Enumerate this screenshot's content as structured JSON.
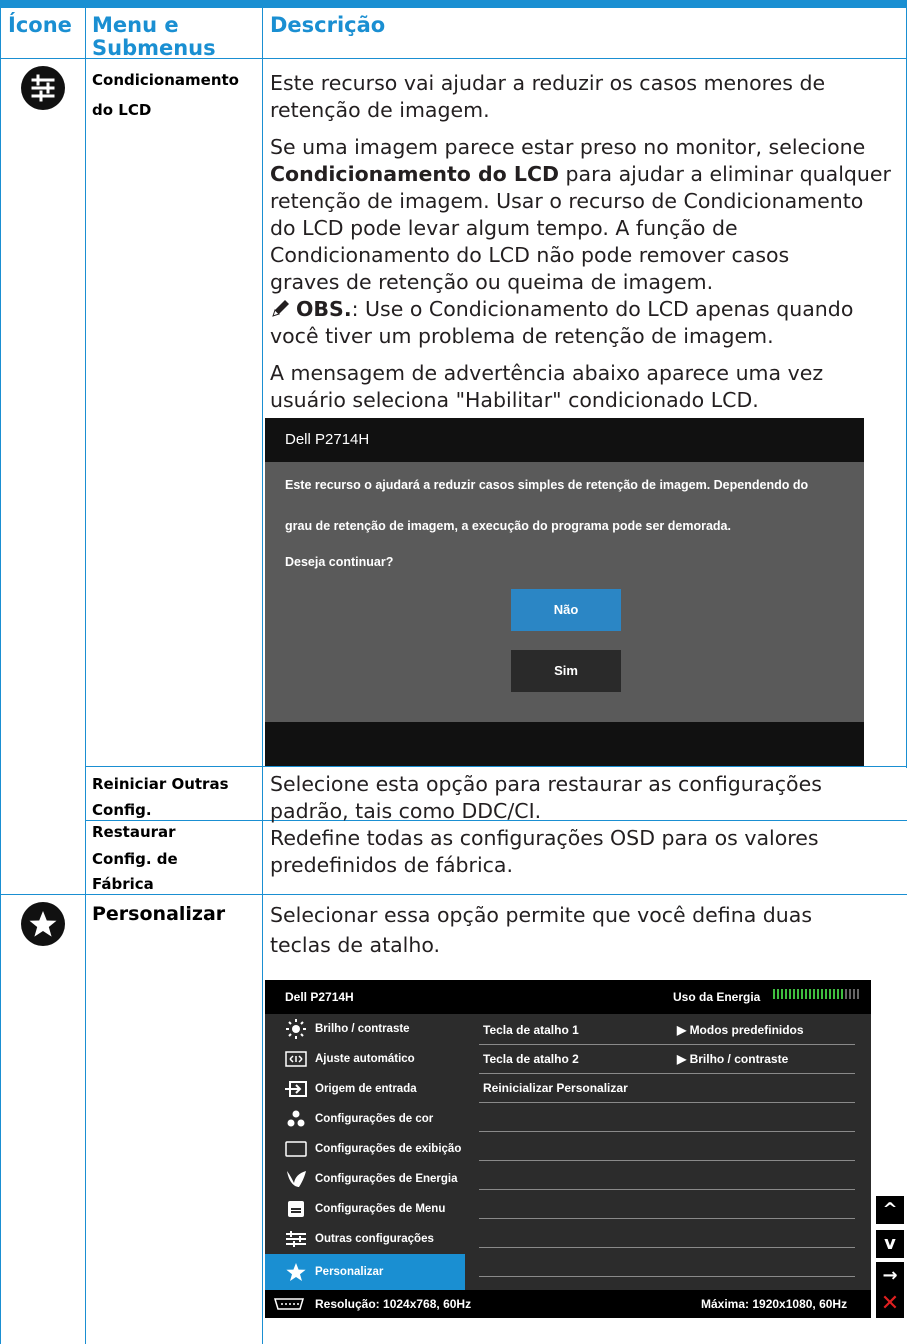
{
  "header": {
    "col_icon": "Ícone",
    "col_menu_line1": "Menu e",
    "col_menu_line2": "Submenus",
    "col_desc": "Descrição"
  },
  "rows": {
    "lcd": {
      "menu_line1": "Condicionamento",
      "menu_line2": "do LCD",
      "p1_line1": "Este recurso vai ajudar a reduzir os casos menores de",
      "p1_line2": "retenção de imagem.",
      "p2_line1": "Se uma imagem parece estar preso no monitor, selecione",
      "p2_bold": "Condicionamento do LCD",
      "p2_line2_rest": " para ajudar a eliminar qualquer",
      "p2_line3": "retenção de imagem. Usar o recurso de Condicionamento",
      "p2_line4": "do LCD pode levar algum tempo. A função de",
      "p2_line5": "Condicionamento do LCD não pode remover casos",
      "p2_line6": "graves de retenção ou queima de imagem.",
      "note_bold": "OBS.",
      "note_line1_rest": ": Use o Condicionamento do LCD apenas quando",
      "note_line2": "você tiver um problema de retenção de imagem.",
      "p3_line1": "A mensagem de advertência abaixo aparece uma vez",
      "p3_line2": "usuário seleciona \"Habilitar\" condicionado LCD."
    },
    "reset_other": {
      "menu_line1": "Reiniciar Outras",
      "menu_line2": "Config.",
      "desc_line1": "Selecione esta opção para restaurar as configurações",
      "desc_line2": "padrão, tais como DDC/CI."
    },
    "factory": {
      "menu_line1": "Restaurar",
      "menu_line2": "Config. de",
      "menu_line3": "Fábrica",
      "desc_line1": "Redefine todas as configurações OSD para os valores",
      "desc_line2": "predefinidos de fábrica."
    },
    "personalize": {
      "menu": "Personalizar",
      "desc_line1": "Selecionar essa opção permite que você defina duas",
      "desc_line2": "teclas de atalho."
    }
  },
  "dialog": {
    "title": "Dell P2714H",
    "text_line1": "Este recurso o ajudará a reduzir casos simples de retenção de imagem. Dependendo do",
    "text_line2": "grau de retenção de imagem, a execução do programa pode ser demorada.",
    "question": "Deseja continuar?",
    "btn_no": "Não",
    "btn_yes": "Sim",
    "colors": {
      "no_button": "#2b86c5",
      "yes_button": "#2a2a2a"
    }
  },
  "osd": {
    "model": "Dell P2714H",
    "energy_label": "Uso da Energia",
    "menu_items": [
      "Brilho / contraste",
      "Ajuste automático",
      "Origem de entrada",
      "Configurações de cor",
      "Configurações de exibição",
      "Configurações de Energia",
      "Configurações de Menu",
      "Outras configurações",
      "Personalizar"
    ],
    "selected_item": "Personalizar",
    "right_rows": [
      {
        "label": "Tecla de atalho 1",
        "value": "Modos predefinidos"
      },
      {
        "label": "Tecla de atalho 2",
        "value": "Brilho / contraste"
      },
      {
        "label": "Reinicializar Personalizar",
        "value": ""
      }
    ],
    "resolution": "Resolução: 1024x768, 60Hz",
    "max_resolution": "Máxima: 1920x1080, 60Hz",
    "nav_icons": [
      "up-arrow-icon",
      "down-arrow-icon",
      "right-arrow-icon",
      "close-x-icon"
    ],
    "nav_glyphs": {
      "up": "^",
      "down": "v",
      "right": "→",
      "close": "✕"
    }
  },
  "colors": {
    "accent": "#1a8fd2",
    "osd_selected": "#1a8fd2",
    "close_red": "#e02020"
  }
}
